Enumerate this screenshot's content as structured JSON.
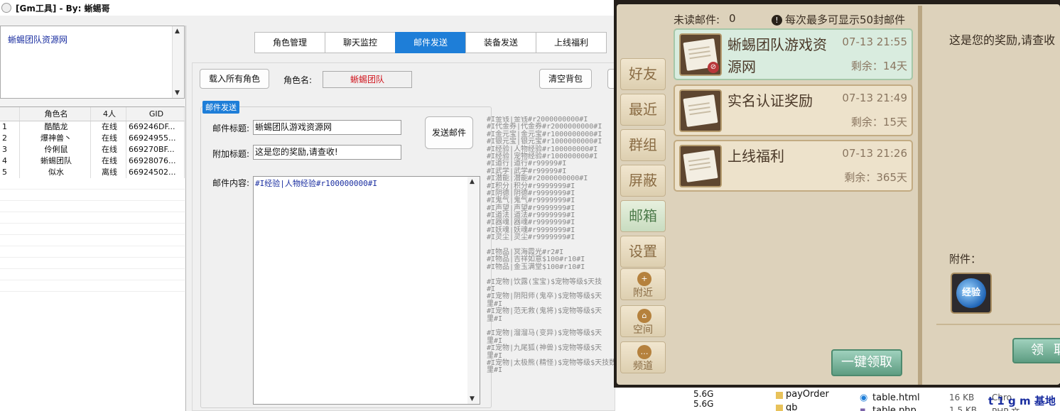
{
  "tool": {
    "title": "[Gm工具] - By: 蜥蜴哥",
    "note_link": "蜥蜴团队资源网",
    "grid": {
      "headers": [
        "",
        "角色名",
        "4人",
        "GID"
      ],
      "rows": [
        [
          "1",
          "酷酷龙",
          "在线",
          "669246DF..."
        ],
        [
          "2",
          "爆神兽丶",
          "在线",
          "66924955..."
        ],
        [
          "3",
          "伶俐鼠",
          "在线",
          "669270BF..."
        ],
        [
          "4",
          "蜥蜴团队",
          "在线",
          "66928076..."
        ],
        [
          "5",
          "似水",
          "离线",
          "66924502..."
        ]
      ]
    },
    "tabs": [
      "角色管理",
      "聊天监控",
      "邮件发送",
      "装备发送",
      "上线福利"
    ],
    "active_tab": "邮件发送",
    "load_all_button": "载入所有角色",
    "role_name_label": "角色名:",
    "role_name_value": "蜥蜴团队",
    "clear_bag_button": "清空背包",
    "mail_group_label": "邮件发送",
    "mail_title_label": "邮件标题:",
    "mail_title_value": "蜥蜴团队游戏资源网",
    "extra_title_label": "附加标题:",
    "extra_title_value": "这是您的奖励,请查收!",
    "content_label": "邮件内容:",
    "content_value": "#I经验|人物经验#r100000000#I",
    "send_button": "发送邮件",
    "codes": [
      "#I金钱|金钱#r2000000000#I",
      "#I代金券|代金券#r2000000000#I",
      "#I金元宝|金元宝#r1000000000#I",
      "#I银元宝|银元宝#r1000000000#I",
      "#I经验|人物经验#r100000000#I",
      "#I经验|宠物经验#r100000000#I",
      "#I道行|道行#r99999#I",
      "#I武学|武学#r99999#I",
      "#I潜能|潜能#r2000000000#I",
      "#I积分|积分#r9999999#I",
      "#I阴德|阴德#r9999999#I",
      "#I鬼气|鬼气#r9999999#I",
      "#I声望|声望#r9999999#I",
      "#I道法|道法#r9999999#I",
      "#I器魂|器魂#r9999999#I",
      "#I妖魂|妖魂#r9999999#I",
      "#I灵尘|灵尘#r9999999#I",
      "",
      "#I物品|冥海霞光#r2#I",
      "#I物品|吉祥如意$100#r10#I",
      "#I物品|金玉满堂$100#r10#I",
      "",
      "#I宠物|饮露(宝宝)$宠物等级$天技",
      "#I",
      "#I宠物|阴阳师(鬼卒)$宠物等级$天",
      "里#I",
      "#I宠物|范无救(鬼将)$宠物等级$天",
      "里#I",
      "",
      "#I宠物|溜溜马(变异)$宠物等级$天",
      "里#I",
      "#I宠物|九尾狐(神兽)$宠物等级$天",
      "里#I",
      "#I宠物|太极熊(精怪)$宠物等级$天技数",
      "里#I"
    ]
  },
  "game": {
    "unread_label": "未读邮件:",
    "unread_count": "0",
    "max_note": "每次最多可显示50封邮件",
    "sidebar": [
      "好友",
      "最近",
      "群组",
      "屏蔽",
      "邮箱",
      "设置",
      "附近",
      "空间",
      "频道"
    ],
    "active_side": "邮箱",
    "mails": [
      {
        "title": "蜥蜴团队游戏资源网",
        "time": "07-13 21:55",
        "remaining": "剩余：14天"
      },
      {
        "title": "实名认证奖励",
        "time": "07-13 21:49",
        "remaining": "剩余：15天"
      },
      {
        "title": "上线福利",
        "time": "07-13 21:26",
        "remaining": "剩余：365天"
      }
    ],
    "detail_text": "这是您的奖励,请查收",
    "attachment_label": "附件：",
    "exp_icon_text": "经验",
    "claim_all_button": "一键领取",
    "claim_button": "领取"
  },
  "files": {
    "size1": "5.6G",
    "size2": "5.6G",
    "folder1": "payOrder",
    "folder2": "qb",
    "file1": "table.html",
    "file1_size": "16 KB",
    "file1_type": "Chro",
    "file2": "table.php",
    "file2_size": "1.5 KB",
    "file2_type": "PHP 文",
    "watermark": "t 1 g m 基地"
  },
  "colors": {
    "tab_active": "#1e7ed8",
    "role_name_text": "#d0121b",
    "game_frame": "#241f1a",
    "game_panel": "#ddd2bb",
    "mail_selected": "#d9ecdf",
    "claim_button": "#5e9d82"
  }
}
